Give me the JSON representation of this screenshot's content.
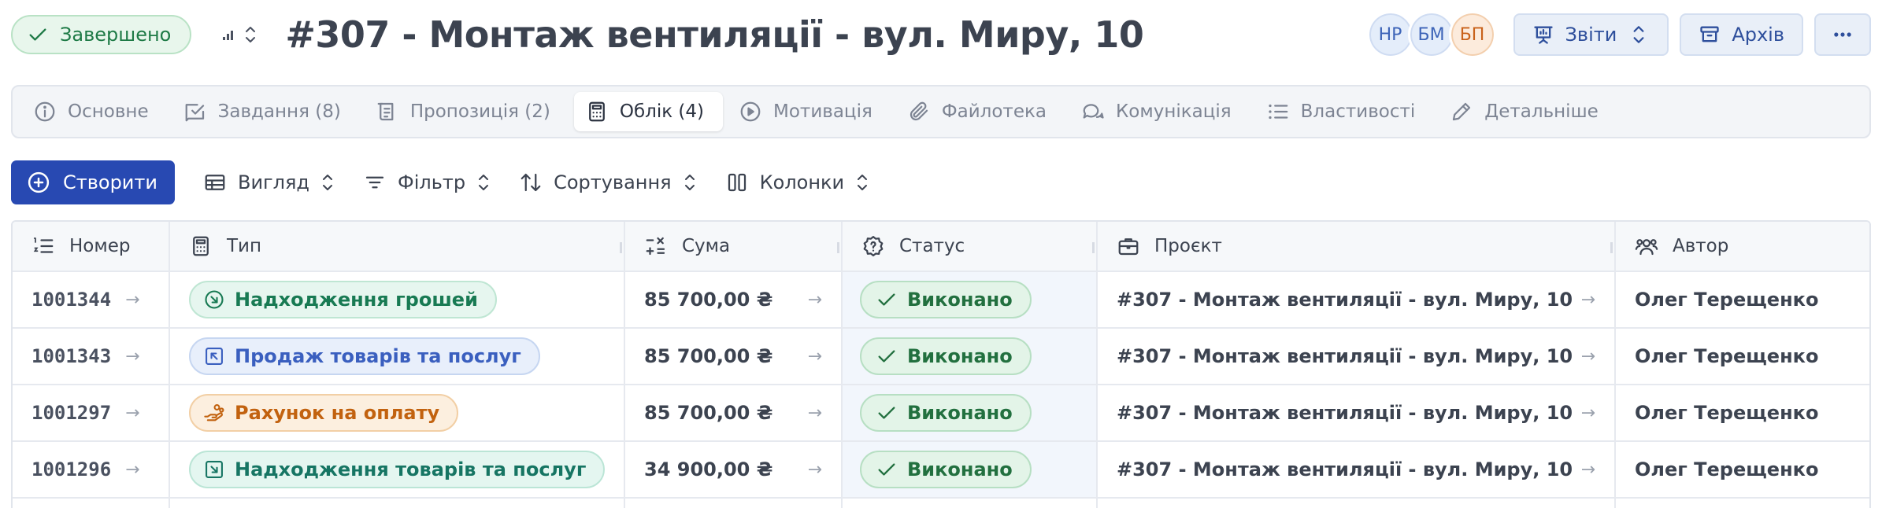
{
  "header": {
    "status_label": "Завершено",
    "title": "#307 - Монтаж вентиляції - вул. Миру, 10",
    "avatars": [
      {
        "initials": "НР",
        "color": "#3d64b8"
      },
      {
        "initials": "БМ",
        "color": "#3d64b8"
      },
      {
        "initials": "БП",
        "color": "#c9621a"
      }
    ],
    "reports_label": "Звіти",
    "archive_label": "Архів"
  },
  "tabs": [
    {
      "label": "Основне",
      "icon": "info-icon"
    },
    {
      "label": "Завдання (8)",
      "icon": "task-icon"
    },
    {
      "label": "Пропозиція (2)",
      "icon": "document-icon"
    },
    {
      "label": "Облік (4)",
      "icon": "calculator-icon",
      "active": true
    },
    {
      "label": "Мотивація",
      "icon": "play-icon"
    },
    {
      "label": "Файлотека",
      "icon": "paperclip-icon"
    },
    {
      "label": "Комунікація",
      "icon": "chat-icon"
    },
    {
      "label": "Властивості",
      "icon": "list-icon"
    },
    {
      "label": "Детальніше",
      "icon": "pencil-icon"
    }
  ],
  "toolbar": {
    "create_label": "Створити",
    "view_label": "Вигляд",
    "filter_label": "Фільтр",
    "sort_label": "Сортування",
    "columns_label": "Колонки"
  },
  "table": {
    "columns": [
      "Номер",
      "Тип",
      "Сума",
      "Статус",
      "Проєкт",
      "Автор"
    ],
    "rows": [
      {
        "number": "1001344",
        "type": "Надходження грошей",
        "type_style": "green",
        "amount": "85 700,00 ₴",
        "status": "Виконано",
        "project": "#307 - Монтаж вентиляції - вул. Миру, 10",
        "author": "Олег Терещенко"
      },
      {
        "number": "1001343",
        "type": "Продаж товарів та послуг",
        "type_style": "blue",
        "amount": "85 700,00 ₴",
        "status": "Виконано",
        "project": "#307 - Монтаж вентиляції - вул. Миру, 10",
        "author": "Олег Терещенко"
      },
      {
        "number": "1001297",
        "type": "Рахунок на оплату",
        "type_style": "orange",
        "amount": "85 700,00 ₴",
        "status": "Виконано",
        "project": "#307 - Монтаж вентиляції - вул. Миру, 10",
        "author": "Олег Терещенко"
      },
      {
        "number": "1001296",
        "type": "Надходження товарів та послуг",
        "type_style": "teal",
        "amount": "34 900,00 ₴",
        "status": "Виконано",
        "project": "#307 - Монтаж вентиляції - вул. Миру, 10",
        "author": "Олег Терещенко"
      }
    ]
  }
}
